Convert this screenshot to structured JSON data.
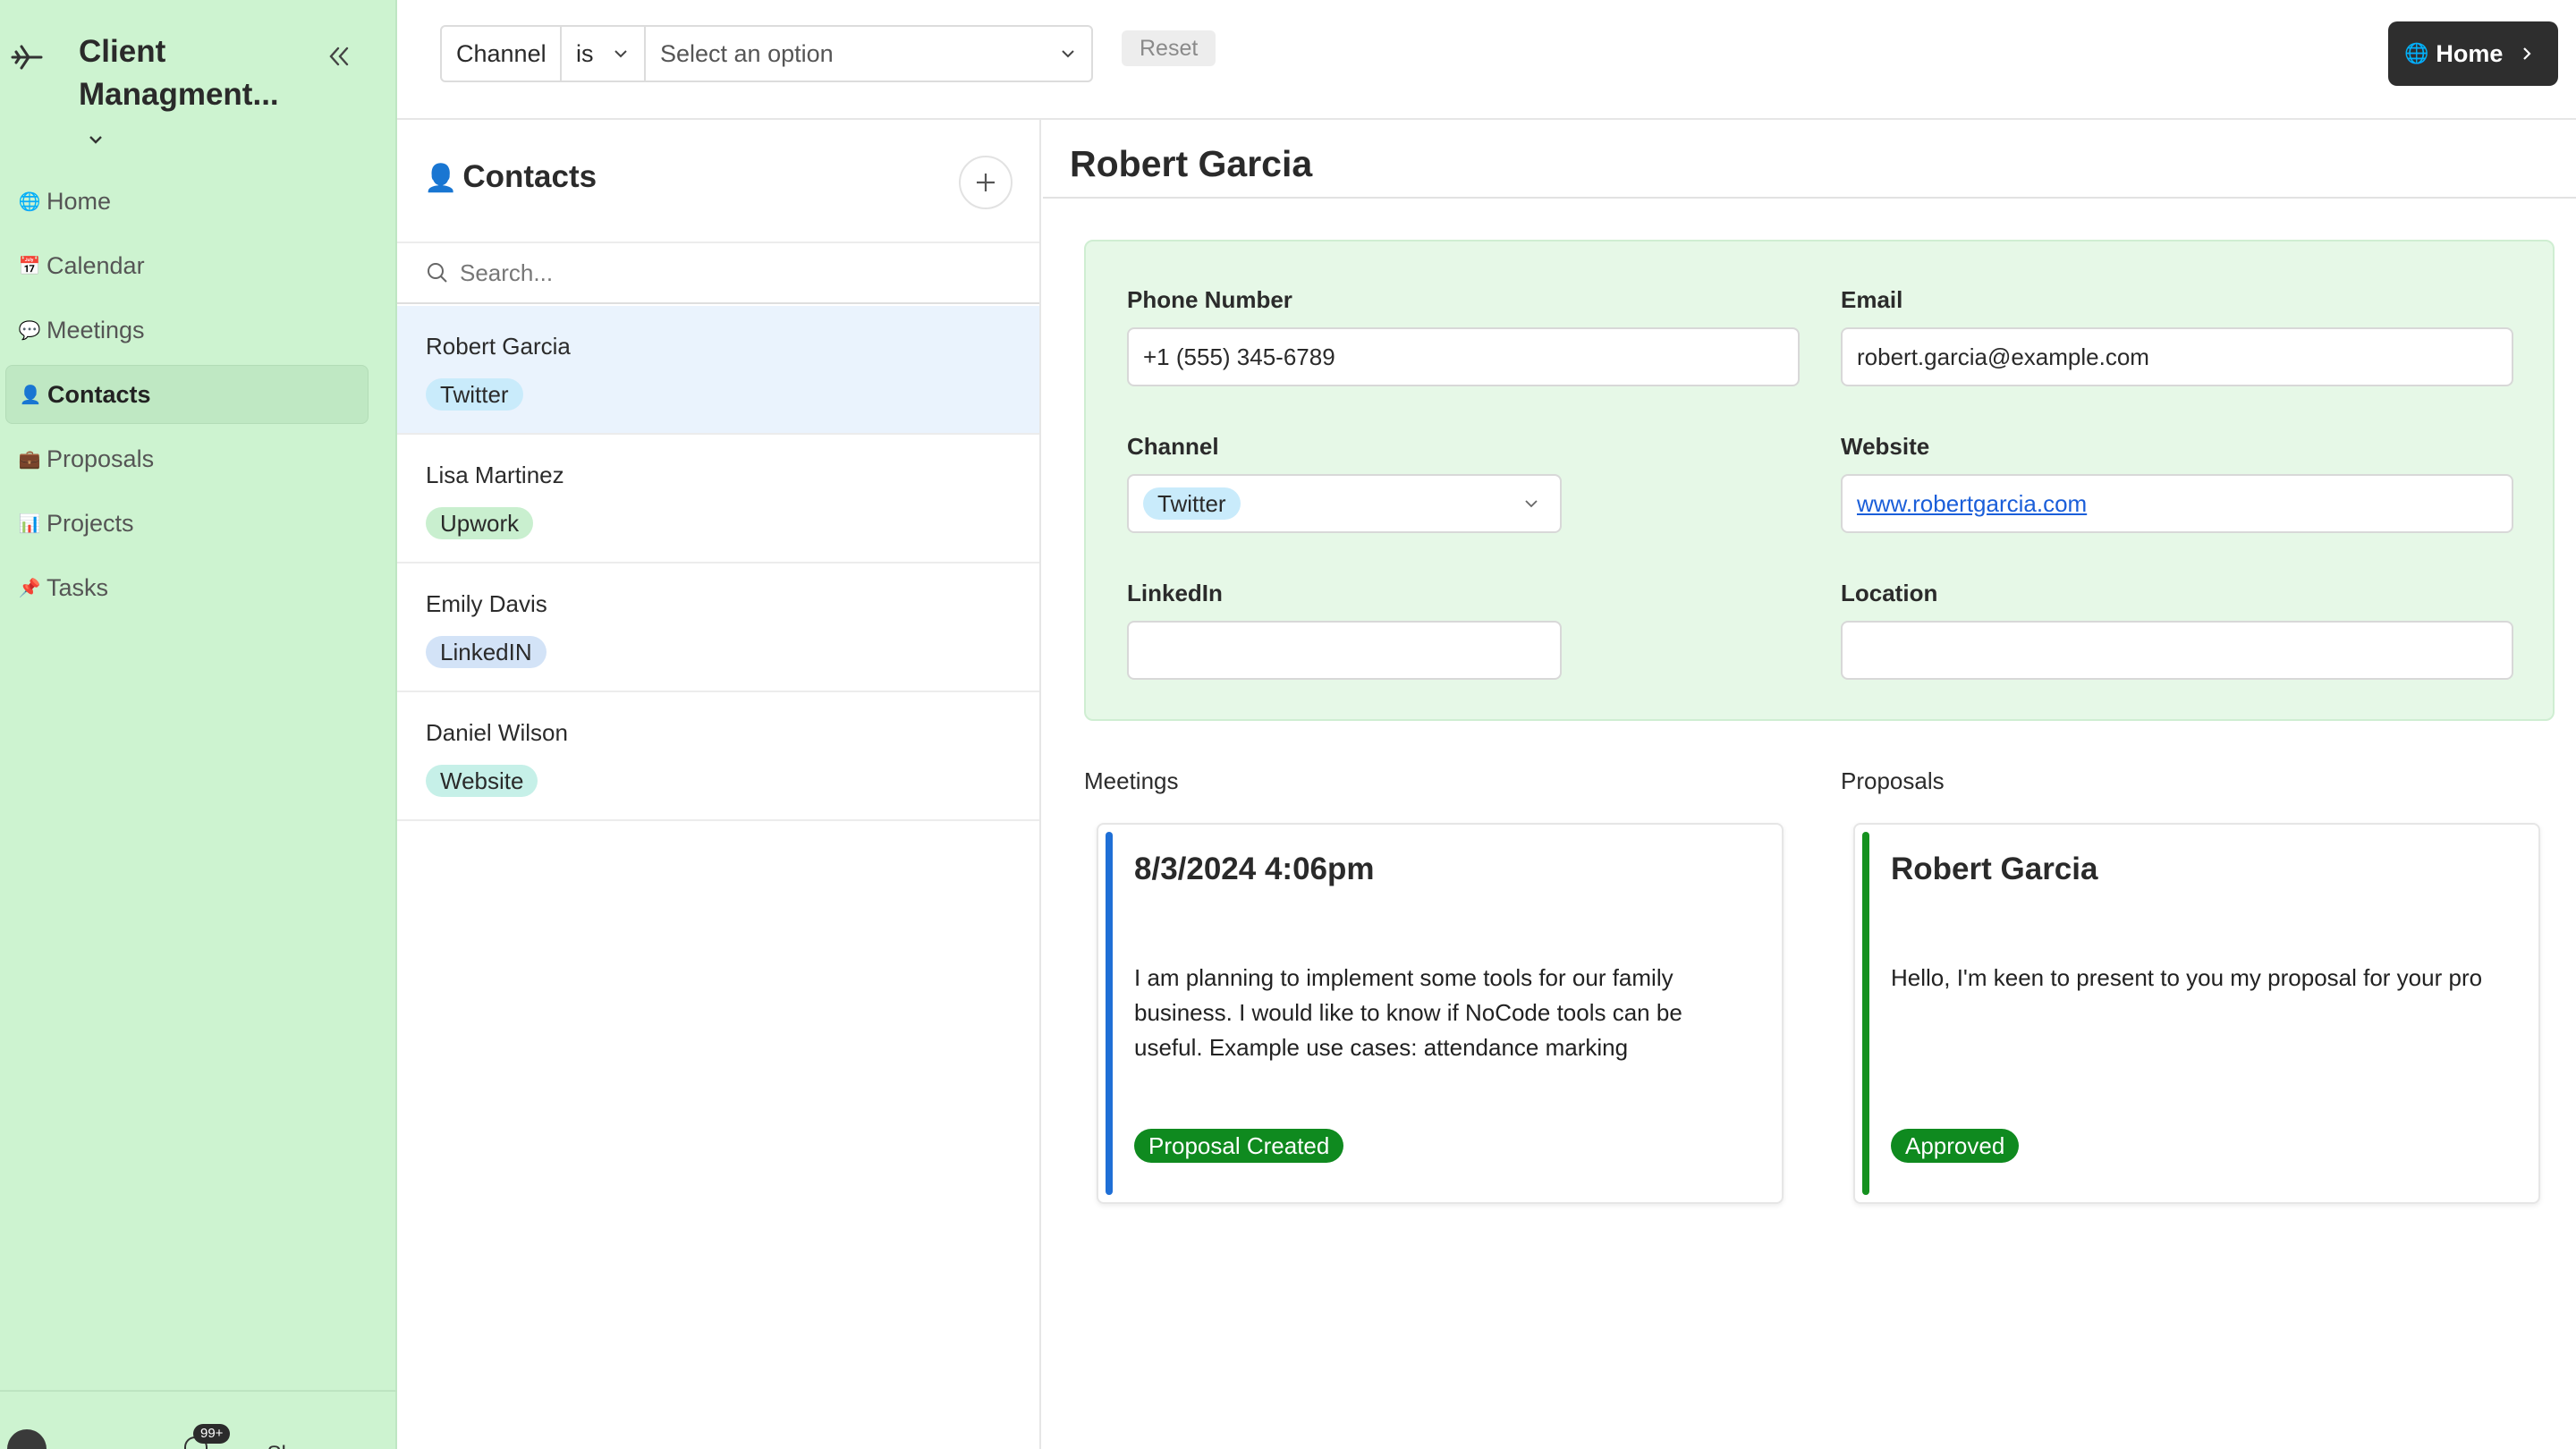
{
  "app": {
    "title": "Client Managment..."
  },
  "sidebar": {
    "items": [
      {
        "icon": "🌐",
        "label": "Home"
      },
      {
        "icon": "📅",
        "label": "Calendar"
      },
      {
        "icon": "💬",
        "label": "Meetings"
      },
      {
        "icon": "👤",
        "label": "Contacts"
      },
      {
        "icon": "💼",
        "label": "Proposals"
      },
      {
        "icon": "📊",
        "label": "Projects"
      },
      {
        "icon": "📌",
        "label": "Tasks"
      }
    ],
    "active_index": 3,
    "notifications_badge": "99+",
    "share_label": "Share"
  },
  "topbar": {
    "filter_field": "Channel",
    "filter_operator": "is",
    "filter_value_placeholder": "Select an option",
    "reset_label": "Reset",
    "home_button_label": "Home",
    "home_button_icon": "🌐"
  },
  "contacts": {
    "header_icon": "👤",
    "header": "Contacts",
    "search_placeholder": "Search...",
    "items": [
      {
        "name": "Robert Garcia",
        "channel": "Twitter",
        "tag_class": "tag-twitter"
      },
      {
        "name": "Lisa Martinez",
        "channel": "Upwork",
        "tag_class": "tag-upwork"
      },
      {
        "name": "Emily Davis",
        "channel": "LinkedIN",
        "tag_class": "tag-linkedin"
      },
      {
        "name": "Daniel Wilson",
        "channel": "Website",
        "tag_class": "tag-website"
      }
    ],
    "selected_index": 0
  },
  "detail": {
    "title": "Robert Garcia",
    "fields": {
      "phone_label": "Phone Number",
      "phone_value": "+1 (555) 345-6789",
      "email_label": "Email",
      "email_value": "robert.garcia@example.com",
      "channel_label": "Channel",
      "channel_value": "Twitter",
      "website_label": "Website",
      "website_value": "www.robertgarcia.com",
      "linkedin_label": "LinkedIn",
      "linkedin_value": "",
      "location_label": "Location",
      "location_value": ""
    },
    "meetings_label": "Meetings",
    "proposals_label": "Proposals",
    "meeting_card": {
      "title": "8/3/2024 4:06pm",
      "body_line1": "I am planning to implement some tools for our family",
      "body_line2": "business. I would like to know if NoCode tools can be",
      "body_line3": "useful. Example use cases: attendance marking",
      "status": "Proposal Created",
      "accent_color": "#1f6fd6"
    },
    "proposal_card": {
      "title": "Robert Garcia",
      "body_line1": "Hello, I'm keen to present to you my proposal for your pro",
      "status": "Approved",
      "accent_color": "#15911f"
    }
  },
  "colors": {
    "sidebar_bg": "#cdf3d0",
    "form_card_bg": "#e6f8e7",
    "status_green": "#0f8a1f",
    "link_blue": "#1a5ed9",
    "selected_row": "#eaf3fd"
  }
}
